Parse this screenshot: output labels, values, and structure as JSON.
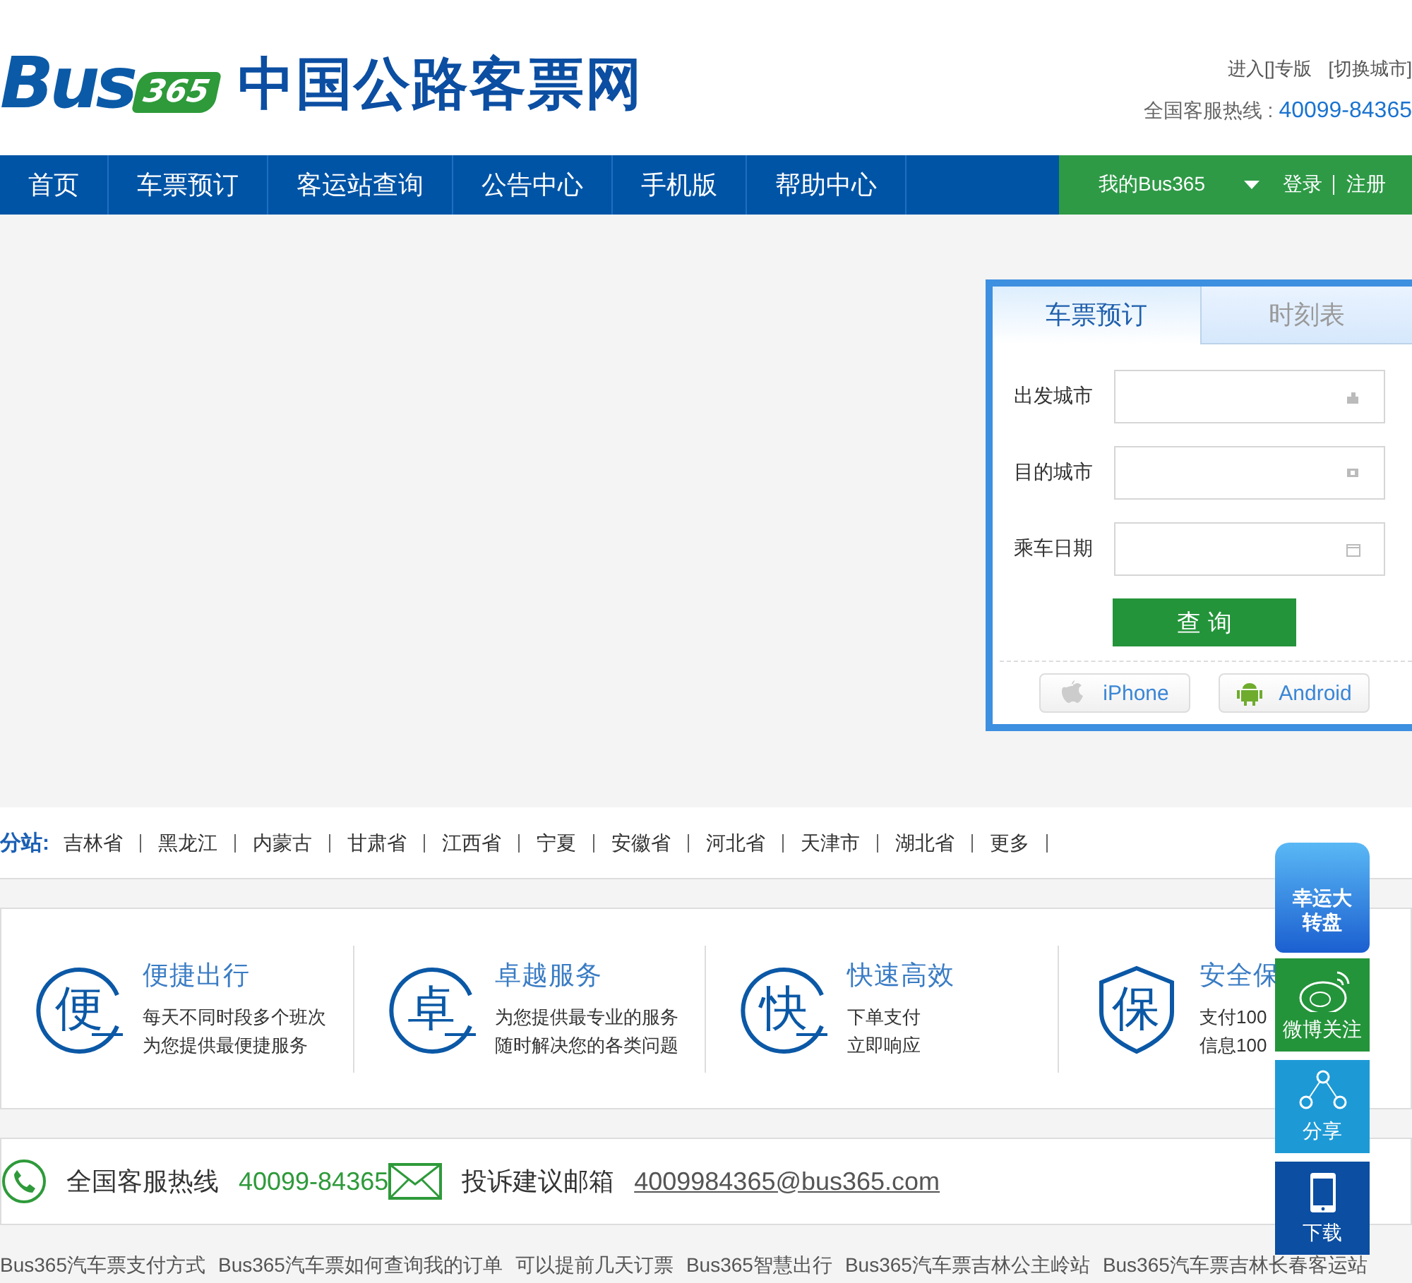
{
  "header": {
    "logo_bus": "Bus",
    "logo_num": "365",
    "site_title": "中国公路客票网",
    "enter_special": "进入[]专版",
    "switch_city": "[切换城市]",
    "hotline_label": "全国客服热线 :",
    "hotline_number": "40099-84365"
  },
  "nav": {
    "items": [
      {
        "label": "首页"
      },
      {
        "label": "车票预订"
      },
      {
        "label": "客运站查询"
      },
      {
        "label": "公告中心"
      },
      {
        "label": "手机版"
      },
      {
        "label": "帮助中心"
      }
    ],
    "account": "我的Bus365",
    "login": "登录",
    "register": "注册"
  },
  "booking": {
    "tabs": [
      {
        "label": "车票预订",
        "selected": true
      },
      {
        "label": "时刻表",
        "selected": false
      }
    ],
    "fields": [
      {
        "label": "出发城市",
        "kind": "city"
      },
      {
        "label": "目的城市",
        "kind": "place"
      },
      {
        "label": "乘车日期",
        "kind": "date"
      }
    ],
    "search_button": "查 询",
    "apps": [
      {
        "label": "iPhone",
        "kind": "apple"
      },
      {
        "label": "Android",
        "kind": "android"
      }
    ]
  },
  "branches": {
    "label": "分站:",
    "items": [
      "吉林省",
      "黑龙江",
      "内蒙古",
      "甘肃省",
      "江西省",
      "宁夏",
      "安徽省",
      "河北省",
      "天津市",
      "湖北省",
      "更多"
    ]
  },
  "features": [
    {
      "icon_char": "便",
      "kind": "circle",
      "title": "便捷出行",
      "lines": [
        "每天不同时段多个班次",
        "为您提供最便捷服务"
      ]
    },
    {
      "icon_char": "卓",
      "kind": "circle",
      "title": "卓越服务",
      "lines": [
        "为您提供最专业的服务",
        "随时解决您的各类问题"
      ]
    },
    {
      "icon_char": "快",
      "kind": "circle",
      "title": "快速高效",
      "lines": [
        "下单支付",
        "立即响应"
      ]
    },
    {
      "icon_char": "保",
      "kind": "shield",
      "title": "安全保",
      "lines": [
        "支付100",
        "信息100"
      ]
    }
  ],
  "contacts": [
    {
      "kind": "phone",
      "label": "全国客服热线",
      "value": "40099-84365"
    },
    {
      "kind": "mail",
      "label": "投诉建议邮箱",
      "value": "4009984365@bus365.com"
    }
  ],
  "footer_links": [
    "Bus365汽车票支付方式",
    "Bus365汽车票如何查询我的订单",
    "可以提前几天订票",
    "Bus365智慧出行",
    "Bus365汽车票吉林公主岭站",
    "Bus365汽车票吉林长春客运站"
  ],
  "float_bar": {
    "lucky": "幸运大转盘",
    "items": [
      {
        "kind": "weibo",
        "label": "微博关注"
      },
      {
        "kind": "share",
        "label": "分享"
      },
      {
        "kind": "download",
        "label": "下载"
      }
    ]
  }
}
